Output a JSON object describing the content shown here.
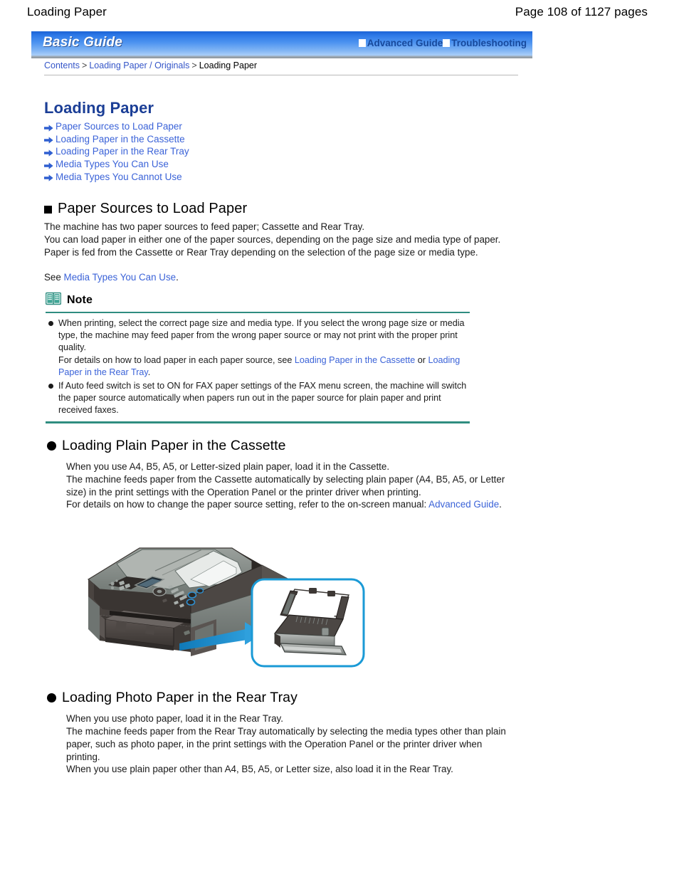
{
  "page_header": {
    "title": "Loading Paper",
    "page_indicator": "Page 108 of 1127 pages"
  },
  "banner": {
    "logo": "Basic Guide",
    "links": [
      {
        "label": "Advanced Guide",
        "icon": "white-square-icon"
      },
      {
        "label": "Troubleshooting",
        "icon": "white-square-icon"
      }
    ]
  },
  "breadcrumb": {
    "items": [
      {
        "label": "Contents",
        "is_link": true
      },
      {
        "label": "Loading Paper / Originals",
        "is_link": true
      },
      {
        "label": "Loading Paper",
        "is_link": false
      }
    ],
    "separator": ">"
  },
  "document": {
    "title": "Loading Paper",
    "toc": [
      {
        "label": "Paper Sources to Load Paper",
        "icon": "blue-arrow-icon"
      },
      {
        "label": "Loading Paper in the Cassette",
        "icon": "blue-arrow-icon"
      },
      {
        "label": "Loading Paper in the Rear Tray",
        "icon": "blue-arrow-icon"
      },
      {
        "label": "Media Types You Can Use",
        "icon": "blue-arrow-icon"
      },
      {
        "label": "Media Types You Cannot Use",
        "icon": "blue-arrow-icon"
      }
    ],
    "section_paper_sources": {
      "heading": "Paper Sources to Load Paper",
      "bullet": "square",
      "para_line1": "The machine has two paper sources to feed paper; Cassette and Rear Tray.",
      "para_line2": "You can load paper in either one of the paper sources, depending on the page size and media type of paper. Paper is fed from the Cassette or Rear Tray depending on the selection of the page size or media type.",
      "see_prefix": "See ",
      "see_link": "Media Types You Can Use",
      "see_suffix": "."
    },
    "note": {
      "icon": "note-book-icon",
      "title": "Note",
      "accent_color": "#2f8d80",
      "items": [
        {
          "text_part1": "When printing, select the correct page size and media type. If you select the wrong page size or media type, the machine may feed paper from the wrong paper source or may not print with the proper print quality.",
          "text_part2": "For details on how to load paper in each paper source, see ",
          "link1": "Loading Paper in the Cassette",
          "text_part3": " or ",
          "link2": "Loading Paper in the Rear Tray",
          "text_part4": "."
        },
        {
          "text_part1": "If Auto feed switch is set to ON for FAX paper settings of the FAX menu screen, the machine will switch the paper source automatically when papers run out in the paper source for plain paper and print received faxes."
        }
      ]
    },
    "section_cassette": {
      "heading": "Loading Plain Paper in the Cassette",
      "bullet": "round",
      "para_line1": "When you use A4, B5, A5, or Letter-sized plain paper, load it in the Cassette.",
      "para_line2": "The machine feeds paper from the Cassette automatically by selecting plain paper (A4, B5, A5, or Letter size) in the print settings with the Operation Panel or the printer driver when printing.",
      "para_line3_prefix": "For details on how to change the paper source setting, refer to the on-screen manual: ",
      "para_line3_link": "Advanced Guide",
      "para_line3_suffix": "."
    },
    "figure": {
      "name": "printer-cassette-illustration",
      "callout_color": "#1a8fd0",
      "inset_border_color": "#1a9ad6"
    },
    "section_rear_tray": {
      "heading": "Loading Photo Paper in the Rear Tray",
      "bullet": "round",
      "para_line1": "When you use photo paper, load it in the Rear Tray.",
      "para_line2": "The machine feeds paper from the Rear Tray automatically by selecting the media types other than plain paper, such as photo paper, in the print settings with the Operation Panel or the printer driver when printing.",
      "para_line3": "When you use plain paper other than A4, B5, A5, or Letter size, also load it in the Rear Tray."
    }
  }
}
